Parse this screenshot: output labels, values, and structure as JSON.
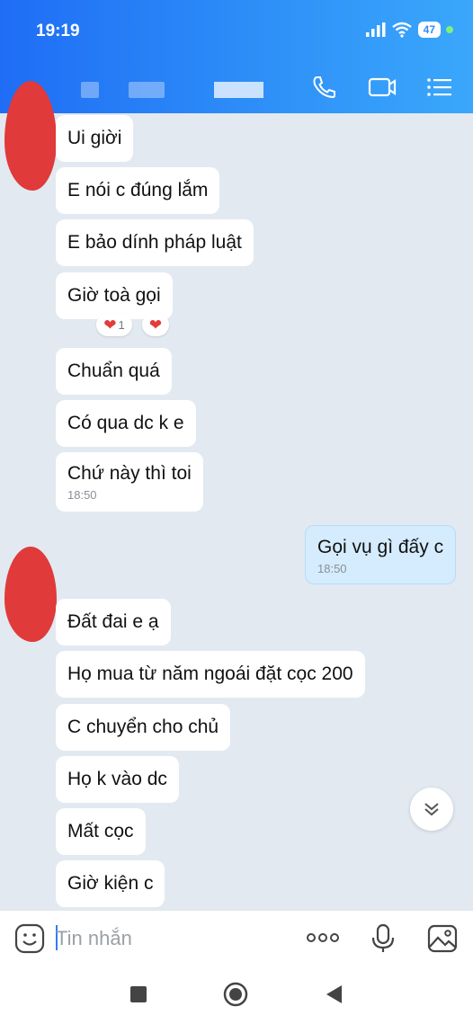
{
  "status_bar": {
    "time": "19:19",
    "battery": "47"
  },
  "header": {
    "icons": [
      "phone-icon",
      "video-call-icon",
      "menu-list-icon"
    ]
  },
  "messages": [
    {
      "text": "Ui giời"
    },
    {
      "text": "E nói c đúng lắm"
    },
    {
      "text": "E bảo dính pháp luật"
    },
    {
      "text": "Giờ toà gọi",
      "reactions": [
        {
          "icon": "heart-icon",
          "count": "1"
        },
        {
          "icon": "heart-icon"
        }
      ]
    },
    {
      "text": "Chuẩn quá"
    },
    {
      "text": "Có qua dc k e"
    },
    {
      "text": "Chứ này thì toi",
      "time": "18:50"
    },
    {
      "text": "Gọi vụ gì đấy c",
      "time": "18:50",
      "mine": true
    },
    {
      "text": "Đất đai e ạ"
    },
    {
      "text": "Họ mua từ năm ngoái đặt cọc 200"
    },
    {
      "text": "C chuyển cho chủ"
    },
    {
      "text": "Họ k vào dc"
    },
    {
      "text": "Mất cọc"
    },
    {
      "text": "Giờ kiện c"
    }
  ],
  "input": {
    "placeholder": "Tin nhắn"
  },
  "colors": {
    "header_start": "#1f6df5",
    "header_end": "#3aa7fb",
    "chat_bg": "#e2e9f1",
    "mine_bubble": "#d4ecfd"
  }
}
